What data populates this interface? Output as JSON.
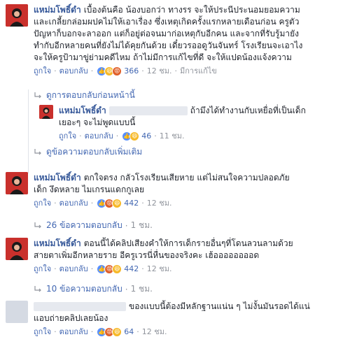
{
  "comments": [
    {
      "name": "แหม่มโพธิ์ดำ",
      "lines": [
        "เบื้องต้นคือ น้องบอกว่า ทางรร จะให้ประนีประนอมยอมความ",
        "และเกลี้ยกล่อมผปคไม่ให้เอาเรื่อง ซึ่งเหตุเกิดครั้งแรกหลายเดือนก่อน ครูตัว",
        "ปัญหาก็บอกจะลาออก แต่ก็อยู่ต่อจนมาก่อเหตุกับอีกคน และจากที่รับรู้มายัง",
        "ทำกับอีกหลายคนที่ยังไม่ได้คุยกันด้วย เดี๋ยวรออดูวันจันทร์ โรงเรียนจะเอาไง",
        "จะให้ครูป้ามาขู่ย่ามคดีไหม ถ้าไม่มีการแก้ไขที่ดี จะให้แปดน้องแจ้งความ"
      ],
      "like": "ถูกใจ",
      "reply": "ตอบกลับ",
      "count": "366",
      "time": "12 ชม.",
      "edited": "มีการแก้ไข"
    },
    {
      "name": "แหม่มโพธิ์ดำ",
      "lines": [
        "ถ้ามึงได้ทำงานกับเหยื่อที่เป็นเด็ก",
        "เยอะๆ จะไม่พูดแบบนี้"
      ],
      "like": "ถูกใจ",
      "reply": "ตอบกลับ",
      "count": "46",
      "time": "11 ชม."
    },
    {
      "name": "แหม่มโพธิ์ดำ",
      "lines": [
        "ตกใจตรง กลัวโรงเรียนเสียหาย แต่ไม่สนใจความปลอดภัย",
        "เด็ก งึดหลาย ไมเกรนแดกกูเลย"
      ],
      "like": "ถูกใจ",
      "reply": "ตอบกลับ",
      "count": "442",
      "time": "12 ชม."
    },
    {
      "name": "แหม่มโพธิ์ดำ",
      "lines": [
        "ตอนนี้ได้คลิปเสียงคำให้การเด็กรายอื่นๆที่โดนลวนลามด้วย",
        "สายตาเพิ่มอีกหลายราย อีครูเวรนี่หื่นของจริงคะ เฮ้ออออออออด"
      ],
      "like": "ถูกใจ",
      "reply": "ตอบกลับ",
      "count": "442",
      "time": "12 ชม."
    },
    {
      "name": "",
      "lines": [
        "ของแบบนี้ต้องมีหลักฐานแน่น ๆ ไม่งั้นมันรอดได้แน่",
        "แอบถ่ายคลิปเลยน้อง"
      ],
      "like": "ถูกใจ",
      "reply": "ตอบกลับ",
      "count": "64",
      "time": "12 ชม."
    }
  ],
  "thread_links": {
    "previous": "ดูการตอบกลับก่อนหน้านี้",
    "more": "ดูข้อความตอบกลับเพิ่มเติม",
    "replies_1": "26 ข้อความตอบกลับ",
    "replies_1_time": "1 ชม.",
    "replies_2": "10 ข้อความตอบกลับ",
    "replies_2_time": "1 ชม."
  },
  "colors": {
    "link": "#4267b2",
    "name": "#365899",
    "muted": "#90949c",
    "avatar": "#c9302c"
  },
  "icons": [
    "reply-arrow-icon",
    "like-reaction-icon",
    "haha-reaction-icon",
    "angry-reaction-icon"
  ]
}
